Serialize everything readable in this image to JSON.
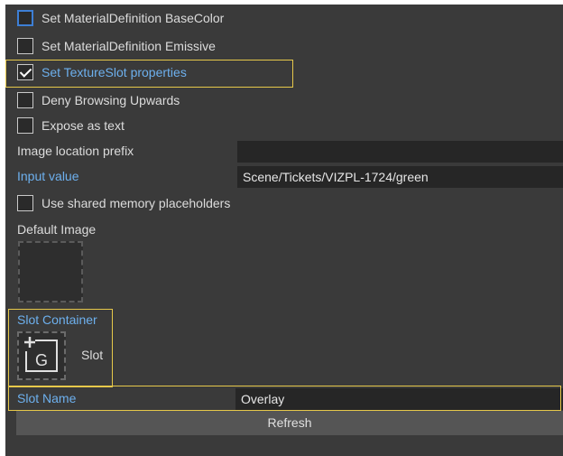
{
  "options": {
    "basecolor": {
      "label": "Set MaterialDefinition BaseColor",
      "checked": false
    },
    "emissive": {
      "label": "Set MaterialDefinition Emissive",
      "checked": false
    },
    "textureslot": {
      "label": "Set TextureSlot properties",
      "checked": true
    },
    "deny_browsing": {
      "label": "Deny Browsing Upwards",
      "checked": false
    },
    "expose_text": {
      "label": "Expose as text",
      "checked": false
    },
    "shared_memory": {
      "label": "Use shared memory placeholders",
      "checked": false
    }
  },
  "image_location_prefix": {
    "label": "Image location prefix",
    "value": ""
  },
  "input_value": {
    "label": "Input value",
    "value": "Scene/Tickets/VIZPL-1724/green"
  },
  "default_image": {
    "label": "Default Image"
  },
  "slot_container": {
    "label": "Slot Container",
    "slot_text": "Slot",
    "tile_glyph": "G"
  },
  "slot_name": {
    "label": "Slot Name",
    "value": "Overlay"
  },
  "refresh_label": "Refresh",
  "colors": {
    "panel_bg": "#3a3a3a",
    "field_bg": "#262626",
    "accent_blue": "#6db0ee",
    "checkbox_focus": "#3d7fd6",
    "highlight_yellow": "#e6c84a",
    "button_bg": "#555555"
  }
}
